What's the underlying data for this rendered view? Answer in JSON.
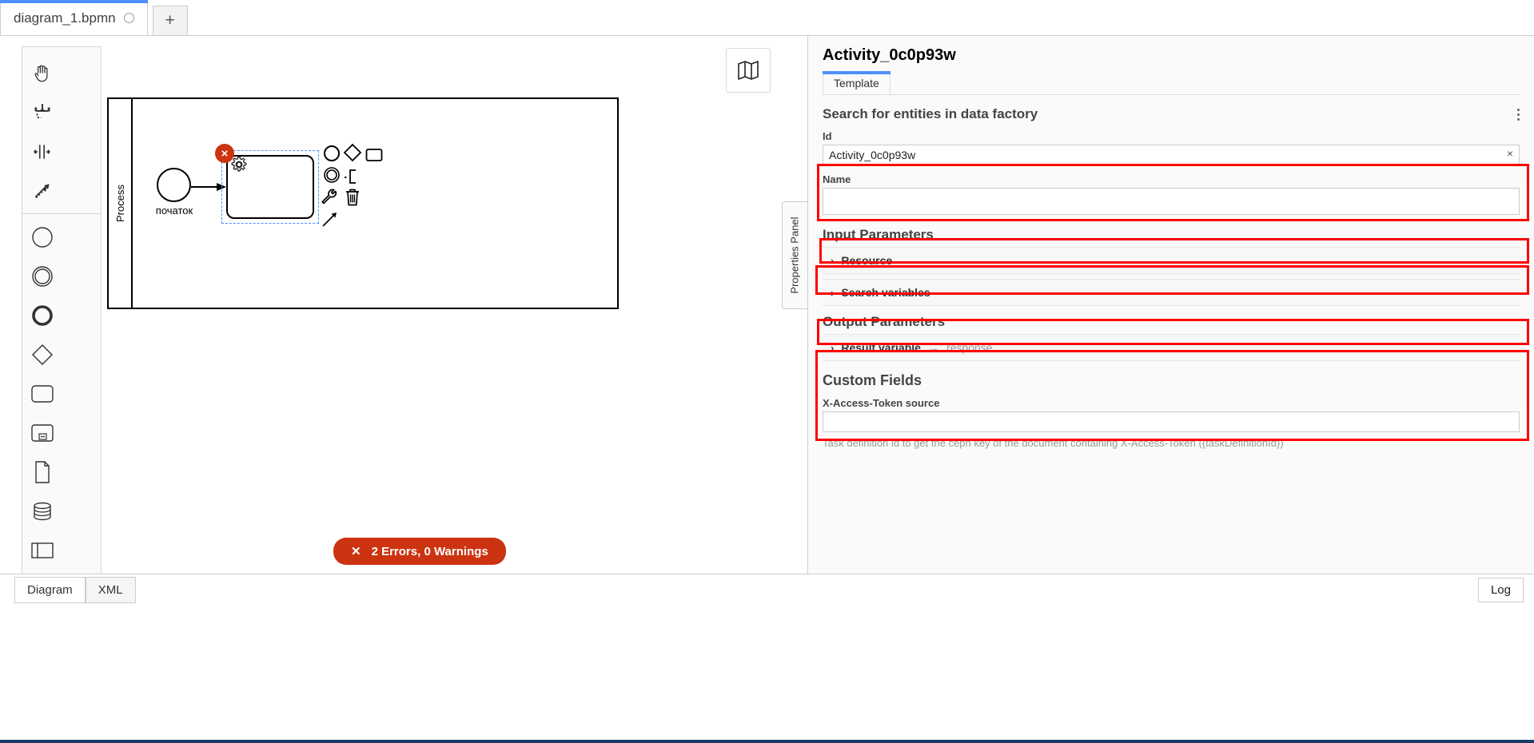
{
  "tabbar": {
    "tabs": [
      {
        "label": "diagram_1.bpmn",
        "dirty": true,
        "active": true
      }
    ],
    "add_label": "+"
  },
  "canvas": {
    "minimap_icon": "map-icon",
    "palette": [
      {
        "icon": "hand-tool-icon",
        "glyph": "hand"
      },
      {
        "icon": "lasso-tool-icon",
        "glyph": "lasso"
      },
      {
        "icon": "space-tool-icon",
        "glyph": "space"
      },
      {
        "icon": "connect-tool-icon",
        "glyph": "connect"
      },
      {
        "icon": "start-event-icon",
        "glyph": "circle-thin"
      },
      {
        "icon": "intermediate-event-icon",
        "glyph": "circle-double"
      },
      {
        "icon": "end-event-icon",
        "glyph": "circle-thick"
      },
      {
        "icon": "gateway-icon",
        "glyph": "diamond"
      },
      {
        "icon": "task-icon",
        "glyph": "rounded-rect"
      },
      {
        "icon": "subprocess-icon",
        "glyph": "subprocess"
      },
      {
        "icon": "data-object-icon",
        "glyph": "document"
      },
      {
        "icon": "data-store-icon",
        "glyph": "cylinder"
      },
      {
        "icon": "participant-icon",
        "glyph": "pool"
      },
      {
        "icon": "group-icon",
        "glyph": "group"
      }
    ],
    "diagram": {
      "pool_label": "Process",
      "start_event_label": "початок",
      "error_badge": "×",
      "task_marker": "service-task-gear",
      "context_pad": [
        {
          "icon": "append-end-event-icon",
          "glyph": "circle"
        },
        {
          "icon": "append-gateway-icon",
          "glyph": "diamond"
        },
        {
          "icon": "append-task-icon",
          "glyph": "rect"
        },
        {
          "icon": "append-intermediate-event-icon",
          "glyph": "circle-double"
        },
        {
          "icon": "append-text-annotation-icon",
          "glyph": "annotation"
        },
        {
          "icon": "change-type-icon",
          "glyph": "wrench"
        },
        {
          "icon": "delete-icon",
          "glyph": "trash"
        },
        {
          "icon": "connect-icon",
          "glyph": "arrow"
        }
      ]
    },
    "error_banner": {
      "icon": "close-icon",
      "label": "2 Errors, 0 Warnings"
    }
  },
  "properties_panel": {
    "toggle_label": "Properties Panel",
    "title": "Activity_0c0p93w",
    "tabs": [
      {
        "label": "Template",
        "active": true
      }
    ],
    "template_group": {
      "title": "Search for entities in data factory",
      "menu_icon": "kebab-menu-icon"
    },
    "fields": {
      "id_label": "Id",
      "id_value": "Activity_0c0p93w",
      "id_clear": "×",
      "name_label": "Name",
      "name_value": ""
    },
    "input_parameters": {
      "title": "Input Parameters",
      "items": [
        {
          "label": "Resource",
          "chevron": "›"
        },
        {
          "label": "Search variables",
          "chevron": "›"
        }
      ]
    },
    "output_parameters": {
      "title": "Output Parameters",
      "items": [
        {
          "label": "Result variable",
          "chevron": "›",
          "arrow": "→",
          "value": "response"
        }
      ]
    },
    "custom_fields": {
      "title": "Custom Fields",
      "field_label": "X-Access-Token source",
      "field_value": "",
      "help_text": "Task definition id to get the ceph key of the document containing X-Access-Token ({taskDefinitionId})"
    }
  },
  "bottom": {
    "tabs": [
      {
        "label": "Diagram",
        "active": true
      },
      {
        "label": "XML",
        "active": false
      }
    ],
    "log_label": "Log"
  },
  "colors": {
    "accent": "#4d90ff",
    "error": "#cc3311",
    "annotation": "#ff0000",
    "status_strip": "#1a3a6b"
  }
}
